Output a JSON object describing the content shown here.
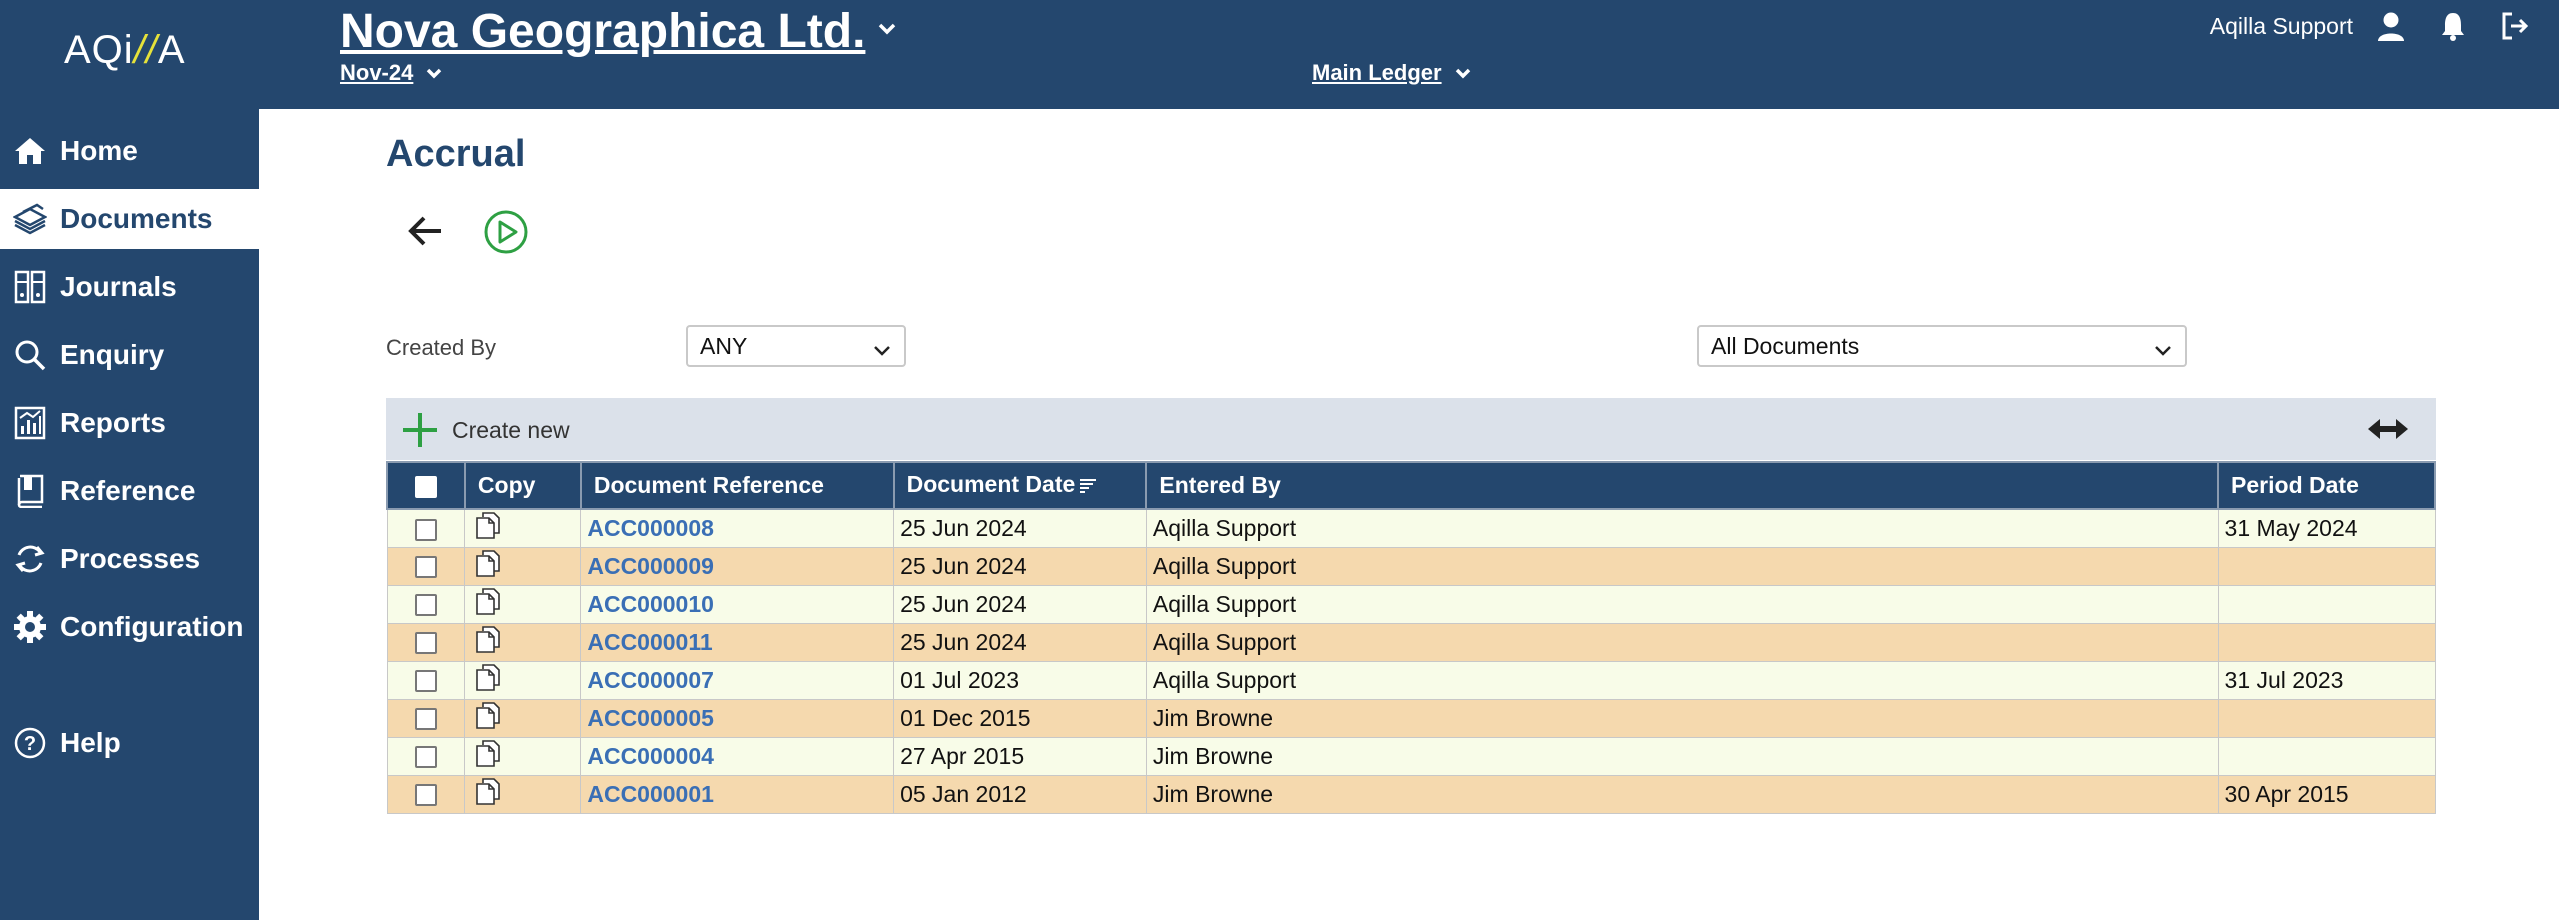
{
  "brand": {
    "logo_left": "AQi",
    "logo_slash": "//",
    "logo_right": "A"
  },
  "header": {
    "company": "Nova Geographica Ltd.",
    "period": "Nov-24",
    "ledger": "Main Ledger",
    "user": "Aqilla Support"
  },
  "sidebar": {
    "items": [
      {
        "label": "Home",
        "icon": "home-icon"
      },
      {
        "label": "Documents",
        "icon": "documents-icon",
        "active": true
      },
      {
        "label": "Journals",
        "icon": "journals-icon"
      },
      {
        "label": "Enquiry",
        "icon": "search-icon"
      },
      {
        "label": "Reports",
        "icon": "reports-icon"
      },
      {
        "label": "Reference",
        "icon": "book-icon"
      },
      {
        "label": "Processes",
        "icon": "refresh-icon"
      },
      {
        "label": "Configuration",
        "icon": "gear-icon"
      }
    ],
    "help": "Help"
  },
  "page": {
    "title": "Accrual",
    "created_by_label": "Created By",
    "created_by_value": "ANY",
    "docs_filter_value": "All Documents",
    "create_new": "Create new"
  },
  "table": {
    "headers": {
      "copy": "Copy",
      "doc_ref": "Document Reference",
      "doc_date": "Document Date",
      "entered_by": "Entered By",
      "period_date": "Period Date"
    },
    "rows": [
      {
        "ref": "ACC000008",
        "date": "25 Jun 2024",
        "entered_by": "Aqilla Support",
        "period_date": "31 May 2024"
      },
      {
        "ref": "ACC000009",
        "date": "25 Jun 2024",
        "entered_by": "Aqilla Support",
        "period_date": ""
      },
      {
        "ref": "ACC000010",
        "date": "25 Jun 2024",
        "entered_by": "Aqilla Support",
        "period_date": ""
      },
      {
        "ref": "ACC000011",
        "date": "25 Jun 2024",
        "entered_by": "Aqilla Support",
        "period_date": ""
      },
      {
        "ref": "ACC000007",
        "date": "01 Jul 2023",
        "entered_by": "Aqilla Support",
        "period_date": "31 Jul 2023"
      },
      {
        "ref": "ACC000005",
        "date": "01 Dec 2015",
        "entered_by": "Jim Browne",
        "period_date": ""
      },
      {
        "ref": "ACC000004",
        "date": "27 Apr 2015",
        "entered_by": "Jim Browne",
        "period_date": ""
      },
      {
        "ref": "ACC000001",
        "date": "05 Jan 2012",
        "entered_by": "Jim Browne",
        "period_date": "30 Apr 2015"
      }
    ]
  },
  "colors": {
    "navy": "#24476e",
    "row_light": "#f8fce8",
    "row_tan": "#f5d9ae",
    "link": "#3a6fb5",
    "run_green": "#2ea043",
    "logo_accent": "#e6e23a"
  }
}
